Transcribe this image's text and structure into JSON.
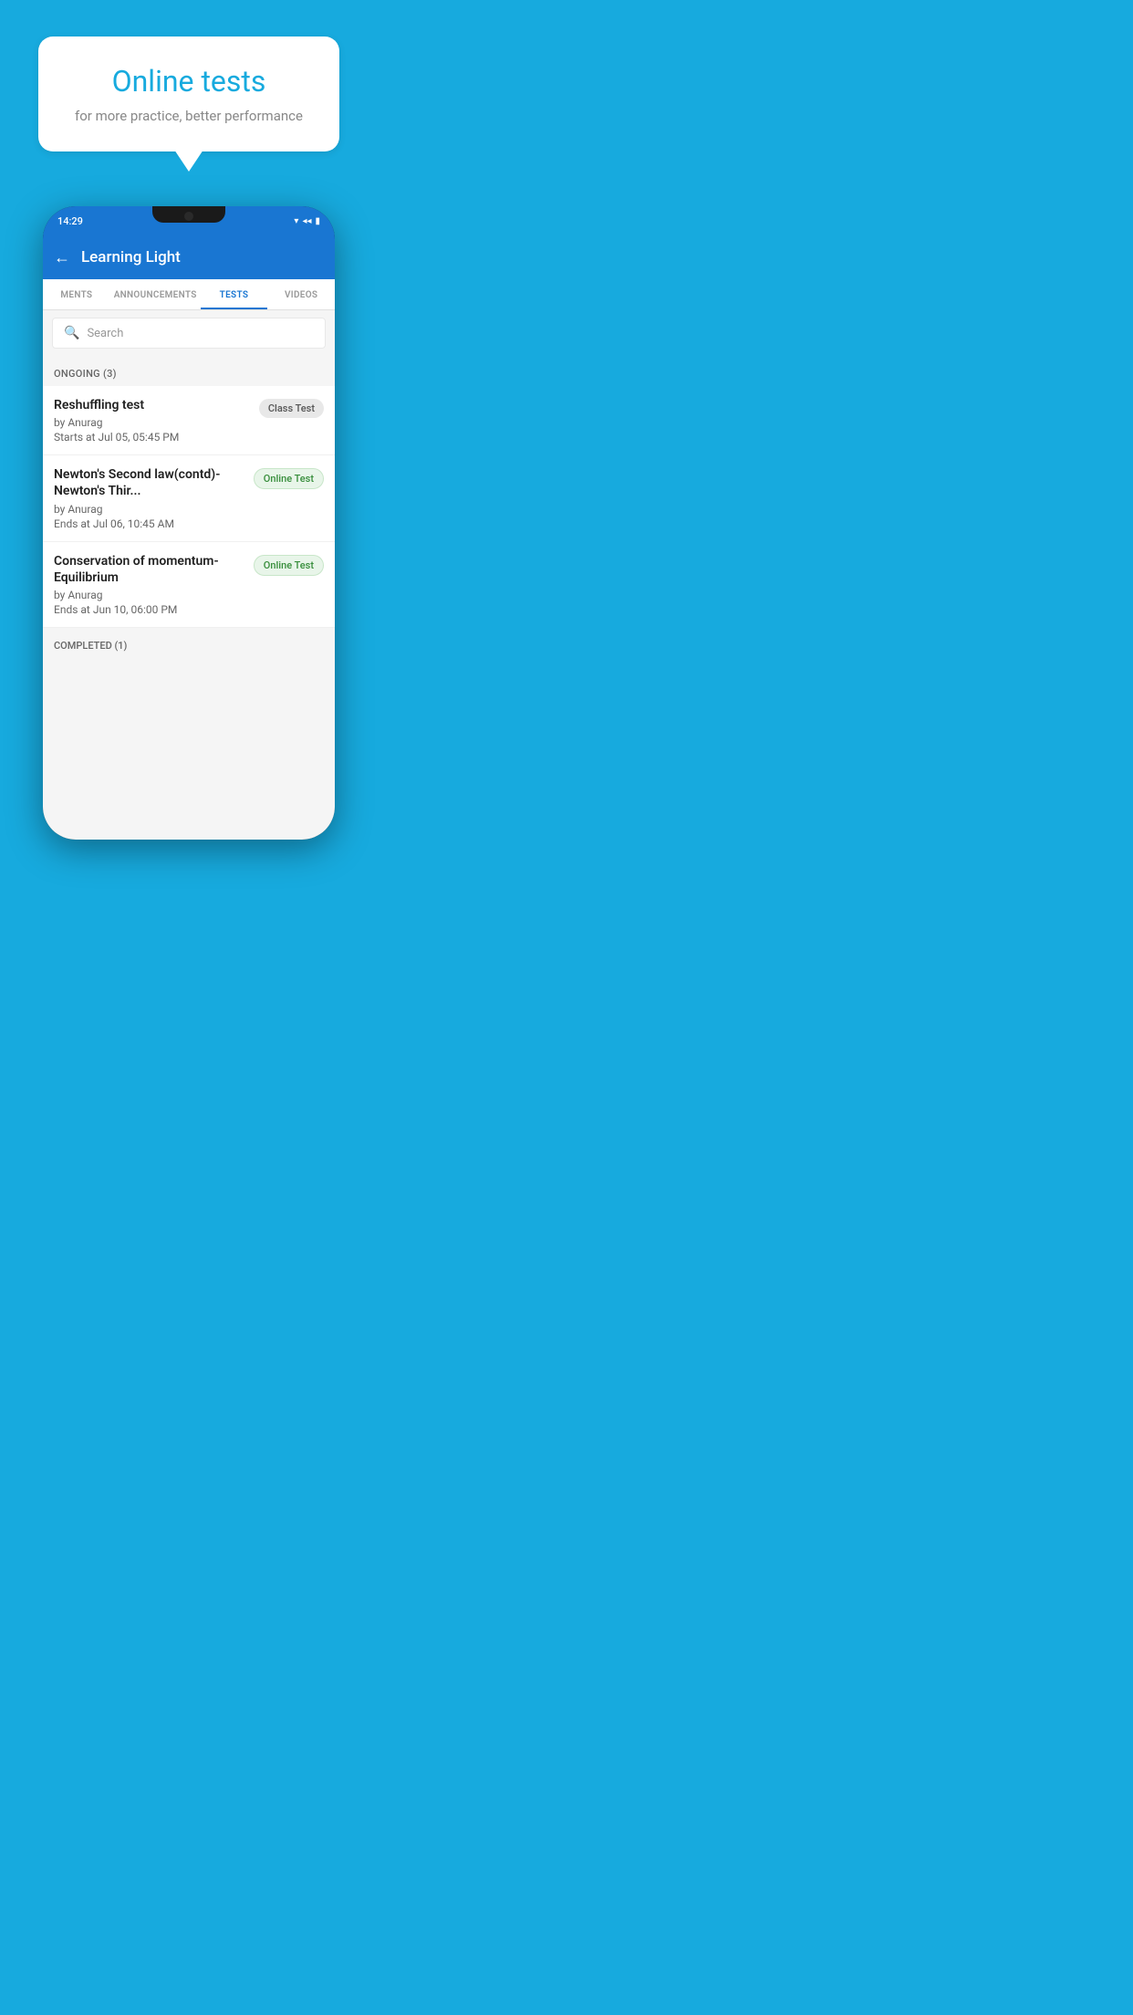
{
  "background_color": "#17AADE",
  "promo": {
    "bubble_title": "Online tests",
    "bubble_subtitle": "for more practice, better performance"
  },
  "phone": {
    "status_bar": {
      "time": "14:29",
      "icons": [
        "wifi",
        "signal",
        "battery"
      ]
    },
    "app_bar": {
      "back_label": "←",
      "title": "Learning Light"
    },
    "tabs": [
      {
        "label": "MENTS",
        "active": false
      },
      {
        "label": "ANNOUNCEMENTS",
        "active": false
      },
      {
        "label": "TESTS",
        "active": true
      },
      {
        "label": "VIDEOS",
        "active": false
      }
    ],
    "search": {
      "placeholder": "Search"
    },
    "ongoing_section": {
      "label": "ONGOING (3)"
    },
    "test_items": [
      {
        "name": "Reshuffling test",
        "author": "by Anurag",
        "time_label": "Starts at",
        "time": "Jul 05, 05:45 PM",
        "badge": "Class Test",
        "badge_type": "class"
      },
      {
        "name": "Newton's Second law(contd)-Newton's Thir...",
        "author": "by Anurag",
        "time_label": "Ends at",
        "time": "Jul 06, 10:45 AM",
        "badge": "Online Test",
        "badge_type": "online"
      },
      {
        "name": "Conservation of momentum-Equilibrium",
        "author": "by Anurag",
        "time_label": "Ends at",
        "time": "Jun 10, 06:00 PM",
        "badge": "Online Test",
        "badge_type": "online"
      }
    ],
    "completed_section": {
      "label": "COMPLETED (1)"
    }
  }
}
